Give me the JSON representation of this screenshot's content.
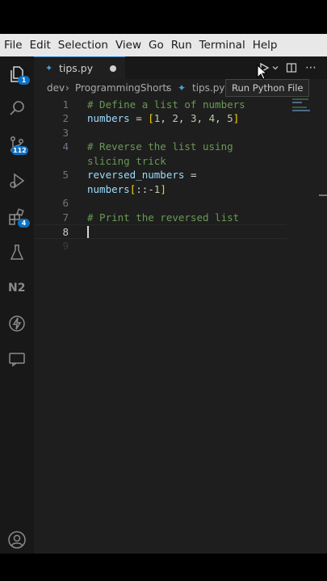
{
  "menu": [
    "File",
    "Edit",
    "Selection",
    "View",
    "Go",
    "Run",
    "Terminal",
    "Help"
  ],
  "activity_bar": {
    "explorer_badge": "1",
    "source_control_badge": "112",
    "extensions_badge": "4"
  },
  "tab": {
    "file_name": "tips.py",
    "lang_icon": "py",
    "modified": true
  },
  "breadcrumbs": {
    "folder1": "dev",
    "folder2": "ProgrammingShorts",
    "file": "tips.py"
  },
  "tooltip": "Run Python File",
  "editor": {
    "line_numbers": [
      "1",
      "2",
      "3",
      "4",
      "",
      "5",
      "",
      "6",
      "7",
      "8",
      "9"
    ],
    "lines": [
      {
        "kind": "comment",
        "text": "# Define a list of numbers"
      },
      {
        "kind": "assign",
        "var": "numbers",
        "op": " = ",
        "open": "[",
        "nums": [
          "1",
          "2",
          "3",
          "4",
          "5"
        ],
        "close": "]"
      },
      {
        "kind": "blank"
      },
      {
        "kind": "comment",
        "text": "# Reverse the list using"
      },
      {
        "kind": "comment",
        "text": "slicing trick"
      },
      {
        "kind": "assign2",
        "var": "reversed_numbers",
        "op": " ="
      },
      {
        "kind": "slice",
        "var": "numbers",
        "open": "[",
        "mid": "::-",
        "num": "1",
        "close": "]"
      },
      {
        "kind": "blank"
      },
      {
        "kind": "comment",
        "text": "# Print the reversed list"
      },
      {
        "kind": "blank"
      },
      {
        "kind": "blank"
      }
    ]
  },
  "colors": {
    "accent": "#0e70c0",
    "comment": "#6a9955",
    "variable": "#9cdcfe",
    "number": "#b5cea8",
    "bracket": "#ffd700"
  }
}
